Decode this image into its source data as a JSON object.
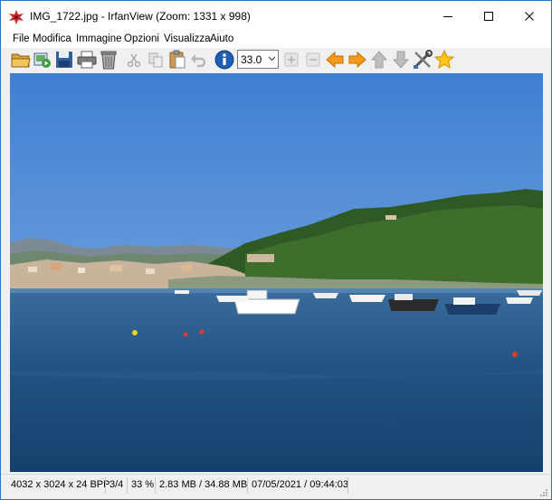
{
  "window": {
    "title": "IMG_1722.jpg - IrfanView (Zoom: 1331 x 998)"
  },
  "menu": {
    "items": [
      "File",
      "Modifica",
      "Immagine",
      "Opzioni",
      "Visualizza",
      "Aiuto"
    ]
  },
  "toolbar": {
    "zoom_value": "33.0"
  },
  "status": {
    "dimensions": "4032 x 3024 x 24 BPP",
    "index": "3/4",
    "zoom_percent": "33 %",
    "size": "2.83 MB / 34.88 MB",
    "datetime": "07/05/2021 / 09:44:03"
  },
  "colors": {
    "accent": "#1d78d1",
    "sky": "#5a90d8",
    "sea": "#1f4f80"
  }
}
